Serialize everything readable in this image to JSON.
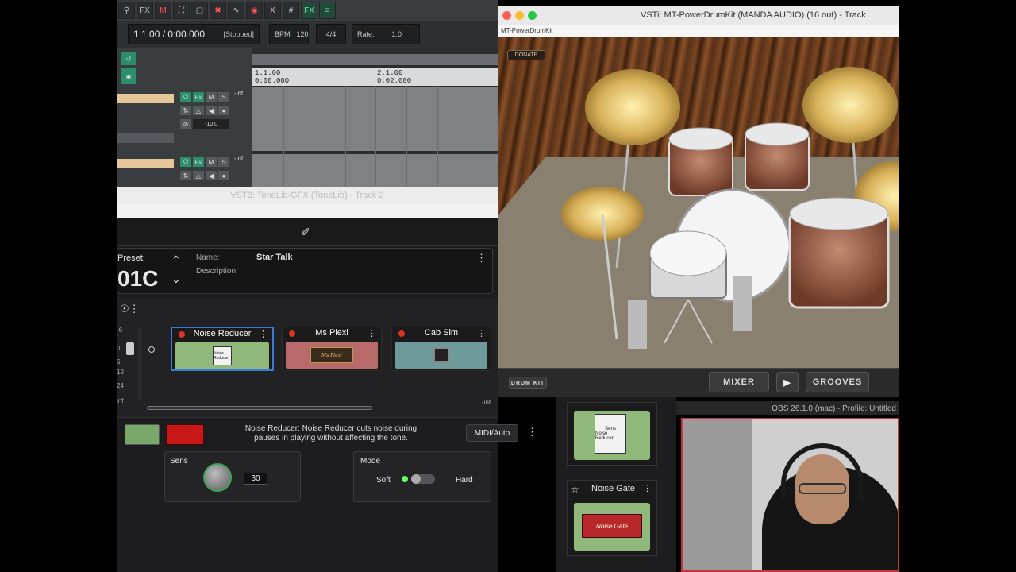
{
  "daw": {
    "toolbar_icons": [
      "zoom-icon",
      "fx-icon",
      "midi-icon",
      "crop-icon",
      "select-icon",
      "delete-icon",
      "wave-icon",
      "record-icon",
      "x-icon",
      "grid-icon",
      "fx-green-icon",
      "mixer-icon"
    ],
    "fx_label": "FX",
    "time_display": "1.1.00 / 0:00.000",
    "status": "[Stopped]",
    "bpm_label": "BPM",
    "bpm_value": "120",
    "time_sig": "4/4",
    "rate_label": "Rate:",
    "rate_value": "1.0",
    "ruler": [
      {
        "bar": "1.1.00",
        "time": "0:00.000"
      },
      {
        "bar": "2.1.00",
        "time": "0:02.000"
      }
    ],
    "track_inf": "-inf",
    "track_volume": "-10.0",
    "track_btn_fx": "Fx",
    "track_btn_m": "M",
    "track_btn_s": "S"
  },
  "tonelib": {
    "window_title": "VST3: ToneLib-GFX (ToneLib) - Track 2",
    "preset_label": "Preset:",
    "preset_number": "01C",
    "name_label": "Name:",
    "name_value": "Star Talk",
    "description_label": "Description:",
    "meter_ticks": [
      "-6",
      "0",
      "6",
      "12",
      "24",
      "inf"
    ],
    "chain": [
      {
        "name": "Noise Reducer",
        "color": "#8fb87a",
        "selected": true
      },
      {
        "name": "Ms Plexi",
        "color": "#b86a6a",
        "selected": false
      },
      {
        "name": "Cab Sim",
        "color": "#6f9a9c",
        "selected": false
      }
    ],
    "plexi_badge": "Ms Plexi",
    "noise_badge": "Noise Reducer",
    "out_inf": "-inf",
    "detail_title": "Noise Reducer:",
    "detail_desc_line1": "Noise Reducer cuts noise during",
    "detail_desc_line2": "pauses in playing without affecting the tone.",
    "midi_auto": "MIDI/Auto",
    "sens_label": "Sens",
    "sens_value": "30",
    "mode_label": "Mode",
    "mode_soft": "Soft",
    "mode_hard": "Hard"
  },
  "drumkit": {
    "window_title": "VSTi: MT-PowerDrumKit (MANDA AUDIO) (16 out) - Track",
    "subtitle": "MT-PowerDrumKit",
    "donate": "DONATE",
    "drum_kit_btn": "DRUM KIT",
    "mixer_btn": "MIXER",
    "grooves_btn": "GROOVES"
  },
  "obs": {
    "title": "OBS 26.1.0 (mac) - Profile: Untitled",
    "noise_gate_label": "Noise Gate",
    "noise_gate_badge": "Noise Gate",
    "noise_reducer_badge": "Noise Reducer",
    "sens_small": "Sens"
  },
  "colors": {
    "accent_green": "#2a8f6a",
    "select_blue": "#3b7bd8",
    "record_red": "#e02020",
    "obs_border": "#c8333b"
  }
}
